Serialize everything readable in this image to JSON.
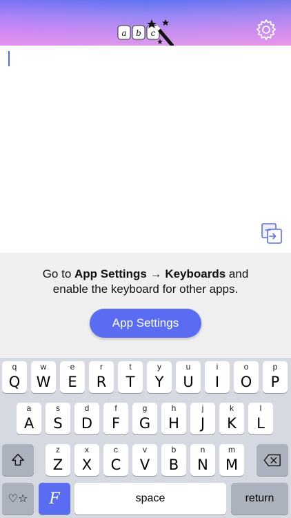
{
  "header": {
    "logo_letters": [
      "a",
      "b",
      "c"
    ],
    "logo_icon": "magic-wand-icon",
    "settings_icon": "gear-icon"
  },
  "editor": {
    "value": "",
    "copy_icon": "copy-to-clipboard-icon"
  },
  "instructions": {
    "prefix": "Go to ",
    "app_settings": "App Settings",
    "arrow": " → ",
    "keyboards": "Keyboards",
    "suffix": " and",
    "line2": "enable the keyboard for other apps.",
    "button_label": "App Settings"
  },
  "keyboard": {
    "row1": [
      {
        "small": "q",
        "big": "Q"
      },
      {
        "small": "w",
        "big": "W"
      },
      {
        "small": "e",
        "big": "E"
      },
      {
        "small": "r",
        "big": "R"
      },
      {
        "small": "t",
        "big": "T"
      },
      {
        "small": "y",
        "big": "Y"
      },
      {
        "small": "u",
        "big": "U"
      },
      {
        "small": "i",
        "big": "I"
      },
      {
        "small": "o",
        "big": "O"
      },
      {
        "small": "p",
        "big": "P"
      }
    ],
    "row2": [
      {
        "small": "a",
        "big": "A"
      },
      {
        "small": "s",
        "big": "S"
      },
      {
        "small": "d",
        "big": "D"
      },
      {
        "small": "f",
        "big": "F"
      },
      {
        "small": "g",
        "big": "G"
      },
      {
        "small": "h",
        "big": "H"
      },
      {
        "small": "j",
        "big": "J"
      },
      {
        "small": "k",
        "big": "K"
      },
      {
        "small": "l",
        "big": "L"
      }
    ],
    "row3": [
      {
        "small": "z",
        "big": "Z"
      },
      {
        "small": "x",
        "big": "X"
      },
      {
        "small": "c",
        "big": "C"
      },
      {
        "small": "v",
        "big": "V"
      },
      {
        "small": "b",
        "big": "B"
      },
      {
        "small": "n",
        "big": "N"
      },
      {
        "small": "m",
        "big": "M"
      }
    ],
    "shift_icon": "shift-icon",
    "delete_icon": "backspace-icon",
    "emoji_label": "♡☆",
    "font_label": "F",
    "space_label": "space",
    "return_label": "return"
  },
  "colors": {
    "accent": "#5a6cf1",
    "keyboard_bg": "#d5d9e2",
    "panel_bg": "#f0f0f0"
  }
}
